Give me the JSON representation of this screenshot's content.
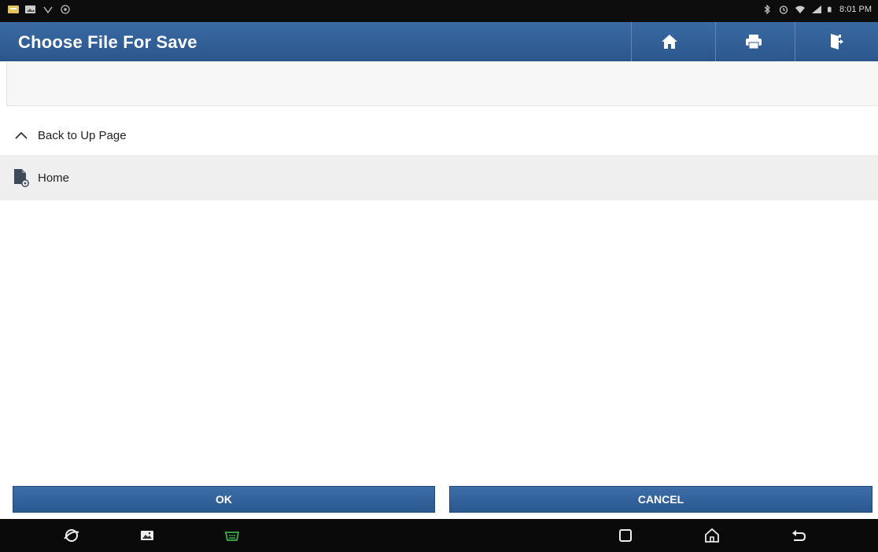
{
  "status_bar": {
    "time": "8:01 PM",
    "left_icons": [
      "notification-icon",
      "gallery-icon",
      "diag-icon",
      "settings-circle-icon"
    ],
    "right_icons": [
      "bluetooth-icon",
      "alarm-icon",
      "wifi-icon",
      "signal-icon",
      "battery-icon"
    ]
  },
  "header": {
    "title": "Choose File For Save",
    "buttons": [
      "home-icon",
      "print-icon",
      "exit-icon"
    ]
  },
  "path": {
    "value": ""
  },
  "list": {
    "up_label": "Back to Up Page",
    "items": [
      {
        "label": "Home",
        "icon": "file-icon"
      }
    ]
  },
  "actions": {
    "ok_label": "OK",
    "cancel_label": "CANCEL"
  },
  "nav_bar": {
    "icons": [
      "browser-icon",
      "gallery-icon",
      "obd-icon",
      "recents-icon",
      "home-icon",
      "back-icon"
    ],
    "obd_color": "#3db34a"
  },
  "colors": {
    "accent": "#2f5e97",
    "title_text": "#ffffff"
  }
}
